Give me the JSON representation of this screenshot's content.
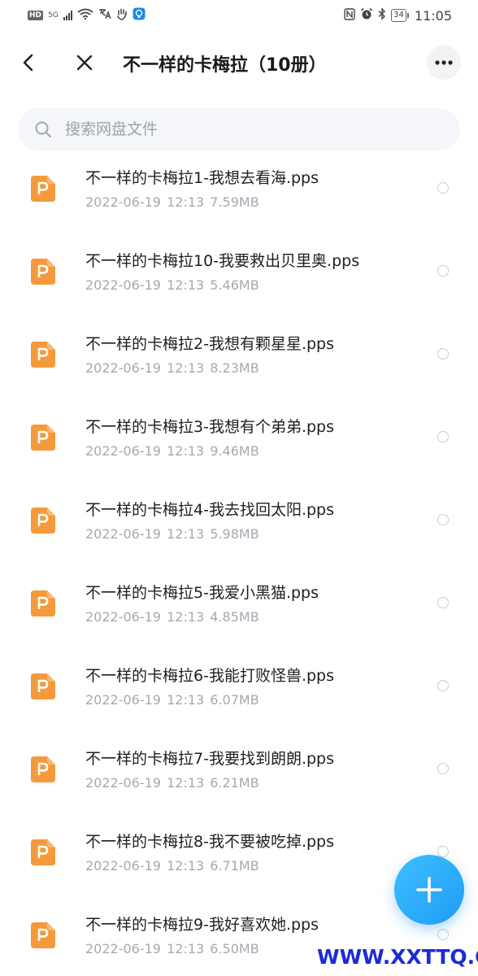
{
  "status_bar": {
    "hd": "HD",
    "net": "5G",
    "time": "11:05",
    "battery": "34"
  },
  "header": {
    "title": "不一样的卡梅拉（10册）"
  },
  "search": {
    "placeholder": "搜索网盘文件"
  },
  "files": [
    {
      "name": "不一样的卡梅拉1-我想去看海.pps",
      "date": "2022-06-19",
      "time": "12:13",
      "size": "7.59MB"
    },
    {
      "name": "不一样的卡梅拉10-我要救出贝里奥.pps",
      "date": "2022-06-19",
      "time": "12:13",
      "size": "5.46MB"
    },
    {
      "name": "不一样的卡梅拉2-我想有颗星星.pps",
      "date": "2022-06-19",
      "time": "12:13",
      "size": "8.23MB"
    },
    {
      "name": "不一样的卡梅拉3-我想有个弟弟.pps",
      "date": "2022-06-19",
      "time": "12:13",
      "size": "9.46MB"
    },
    {
      "name": "不一样的卡梅拉4-我去找回太阳.pps",
      "date": "2022-06-19",
      "time": "12:13",
      "size": "5.98MB"
    },
    {
      "name": "不一样的卡梅拉5-我爱小黑猫.pps",
      "date": "2022-06-19",
      "time": "12:13",
      "size": "4.85MB"
    },
    {
      "name": "不一样的卡梅拉6-我能打败怪兽.pps",
      "date": "2022-06-19",
      "time": "12:13",
      "size": "6.07MB"
    },
    {
      "name": "不一样的卡梅拉7-我要找到朗朗.pps",
      "date": "2022-06-19",
      "time": "12:13",
      "size": "6.21MB"
    },
    {
      "name": "不一样的卡梅拉8-我不要被吃掉.pps",
      "date": "2022-06-19",
      "time": "12:13",
      "size": "6.71MB"
    },
    {
      "name": "不一样的卡梅拉9-我好喜欢她.pps",
      "date": "2022-06-19",
      "time": "12:13",
      "size": "6.50MB"
    }
  ],
  "icons": {
    "file_type": "pps-file-icon",
    "fab": "plus-icon"
  },
  "colors": {
    "file_icon": "#f59a3c",
    "fab": "#23a6f7",
    "watermark": "#1c2bd6"
  },
  "watermark": "WWW.XXTTQ.COM"
}
